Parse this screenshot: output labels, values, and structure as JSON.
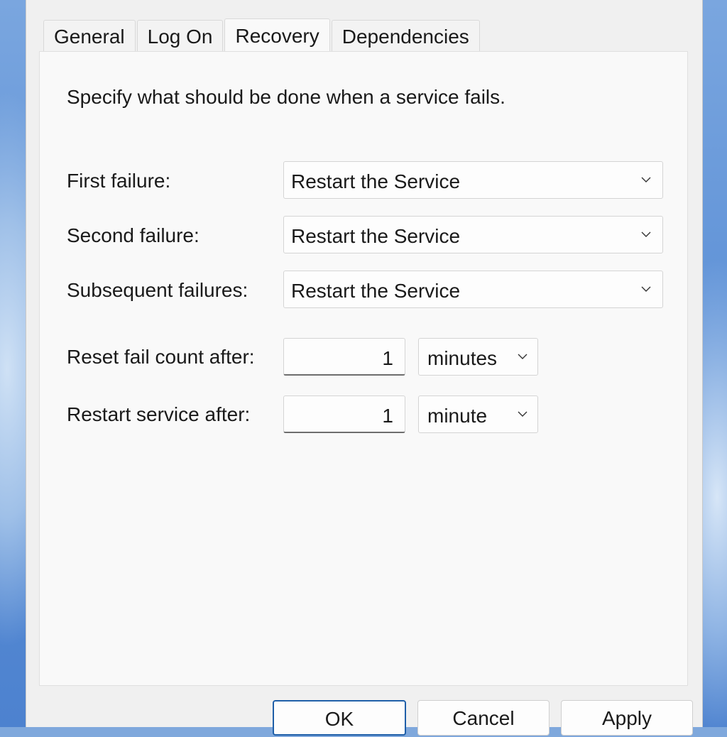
{
  "tabs": [
    {
      "label": "General"
    },
    {
      "label": "Log On"
    },
    {
      "label": "Recovery"
    },
    {
      "label": "Dependencies"
    }
  ],
  "active_tab": "Recovery",
  "recovery": {
    "description": "Specify what should be done when a service fails.",
    "first_failure": {
      "label": "First failure:",
      "value": "Restart the Service"
    },
    "second_failure": {
      "label": "Second failure:",
      "value": "Restart the Service"
    },
    "subsequent_failures": {
      "label": "Subsequent failures:",
      "value": "Restart the Service"
    },
    "reset_fail_count": {
      "label": "Reset fail count after:",
      "value": "1",
      "unit": "minutes"
    },
    "restart_service": {
      "label": "Restart service after:",
      "value": "1",
      "unit": "minute"
    }
  },
  "buttons": {
    "ok": "OK",
    "cancel": "Cancel",
    "apply": "Apply"
  },
  "colors": {
    "dialog_bg": "#f0f0f0",
    "panel_bg": "#f9f9f9",
    "primary_border": "#1f5fa8"
  }
}
